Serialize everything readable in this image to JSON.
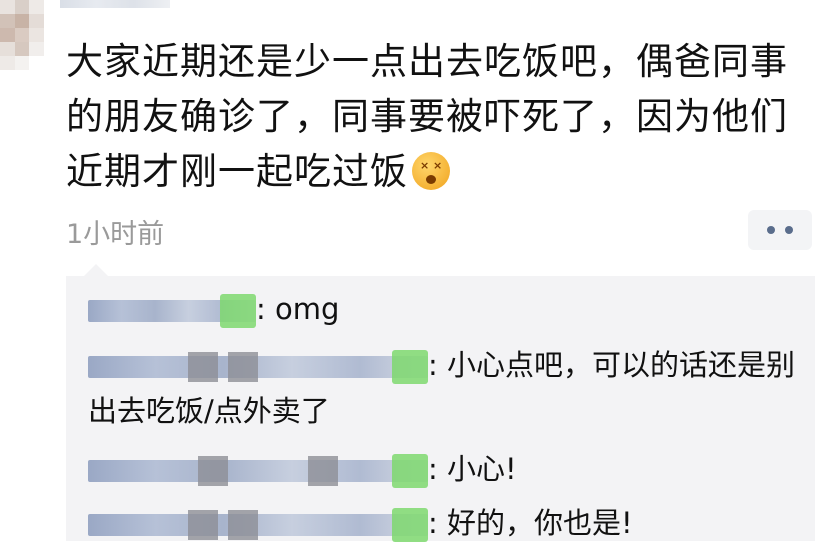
{
  "post": {
    "text": "大家近期还是少一点出去吃饭吧，偶爸同事的朋友确诊了，同事要被吓死了，因为他们近期才刚一起吃过饭",
    "emoji_icon": "dizzy-face-emoji",
    "timestamp": "1小时前",
    "more_icon": "more-dots-icon"
  },
  "comments": [
    {
      "separator": ":",
      "text": " omg"
    },
    {
      "separator": ":",
      "text": " 小心点吧，可以的话还是别出去吃饭/点外卖了"
    },
    {
      "separator": ":",
      "text": " 小心!"
    },
    {
      "separator": ":",
      "text": " 好的，你也是!"
    }
  ],
  "colors": {
    "text": "#111111",
    "timestamp": "#9a9a9a",
    "comment_bg": "#f3f3f5",
    "more_dots": "#5a6d8c"
  }
}
